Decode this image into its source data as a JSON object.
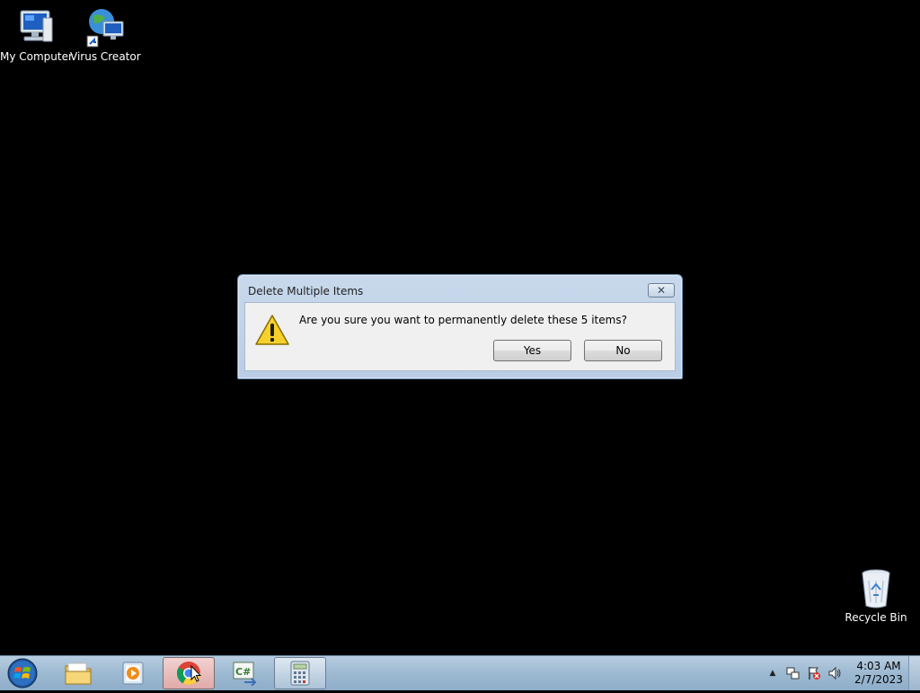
{
  "desktop": {
    "icons": [
      {
        "label": "My Computer",
        "icon": "computer-icon"
      },
      {
        "label": "Virus Creator",
        "icon": "network-globe-icon"
      },
      {
        "label": "Recycle Bin",
        "icon": "recycle-bin-icon"
      }
    ]
  },
  "dialog": {
    "title": "Delete Multiple Items",
    "close_label": "✕",
    "message": "Are you sure you want to permanently delete these 5 items?",
    "yes_label": "Yes",
    "no_label": "No",
    "icon": "warning-icon"
  },
  "taskbar": {
    "start_icon": "windows-start-orb-icon",
    "pinned": [
      {
        "icon": "file-explorer-icon"
      },
      {
        "icon": "media-player-icon"
      },
      {
        "icon": "chrome-icon"
      },
      {
        "icon": "csharp-project-icon"
      },
      {
        "icon": "calculator-icon"
      }
    ],
    "tray_icons": [
      "show-hidden-icons-icon",
      "network-icon",
      "action-center-icon",
      "volume-icon"
    ],
    "tray_expand": "▲",
    "time": "4:03 AM",
    "date": "2/7/2023"
  },
  "colors": {
    "desktop_bg": "#000000",
    "taskbar": "#9fbbd3",
    "dialog_frame": "#b9cde5",
    "dialog_body": "#f0f0f0"
  }
}
